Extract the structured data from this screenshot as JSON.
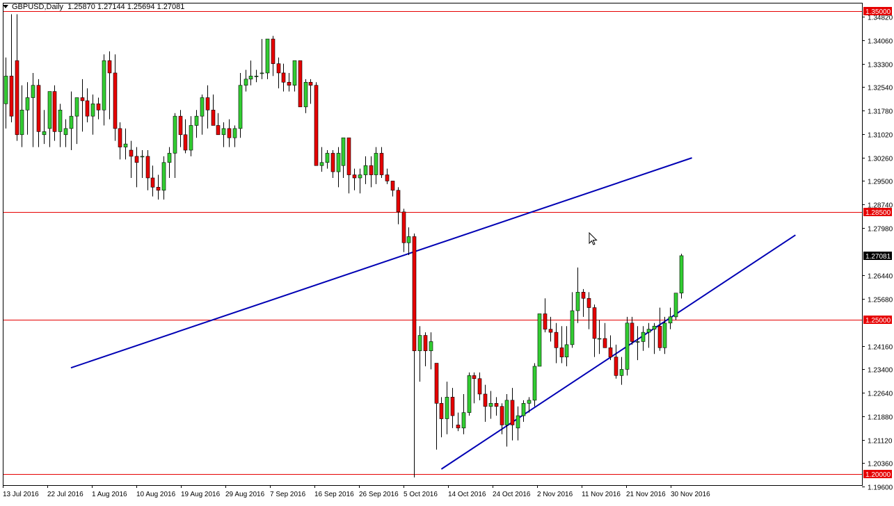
{
  "header": {
    "symbol": "GBPUSD,Daily",
    "ohlc": "1.25870 1.27144 1.25694 1.27081"
  },
  "colors": {
    "bull_fill": "#32cd32",
    "bear_fill": "#e60000",
    "wick": "#000000",
    "hline": "#e60000",
    "trendline": "#0000b4",
    "price_label_bg": "#e60000",
    "current_label_bg": "#000000"
  },
  "chart_data": {
    "type": "candlestick",
    "symbol": "GBPUSD",
    "timeframe": "Daily",
    "last_ohlc": {
      "open": 1.2587,
      "high": 1.27144,
      "low": 1.25694,
      "close": 1.27081
    },
    "ylim": [
      1.1965,
      1.3525
    ],
    "y_ticks": [
      "1.34820",
      "1.34060",
      "1.33300",
      "1.32540",
      "1.31780",
      "1.31020",
      "1.30260",
      "1.29500",
      "1.28740",
      "1.27980",
      "1.26440",
      "1.25680",
      "1.24160",
      "1.23400",
      "1.22640",
      "1.21880",
      "1.21120",
      "1.20360",
      "1.19600"
    ],
    "x_labels": [
      "13 Jul 2016",
      "22 Jul 2016",
      "1 Aug 2016",
      "10 Aug 2016",
      "19 Aug 2016",
      "29 Aug 2016",
      "7 Sep 2016",
      "16 Sep 2016",
      "26 Sep 2016",
      "5 Oct 2016",
      "14 Oct 2016",
      "24 Oct 2016",
      "2 Nov 2016",
      "11 Nov 2016",
      "21 Nov 2016",
      "30 Nov 2016"
    ],
    "horizontal_levels": [
      {
        "price": 1.35,
        "label": "1.35000"
      },
      {
        "price": 1.285,
        "label": "1.28500"
      },
      {
        "price": 1.25,
        "label": "1.25000"
      },
      {
        "price": 1.2,
        "label": "1.20000"
      }
    ],
    "current_price": {
      "price": 1.27081,
      "label": "1.27081"
    },
    "trendlines": [
      {
        "name": "channel-upper",
        "from": [
          12,
          1.2345
        ],
        "to": [
          126,
          1.3025
        ]
      },
      {
        "name": "channel-lower",
        "from": [
          80,
          1.2017
        ],
        "to": [
          145,
          1.2775
        ]
      }
    ],
    "candles": [
      [
        1.32,
        1.335,
        1.312,
        1.329
      ],
      [
        1.329,
        1.349,
        1.314,
        1.316
      ],
      [
        1.334,
        1.349,
        1.308,
        1.31
      ],
      [
        1.31,
        1.326,
        1.306,
        1.318
      ],
      [
        1.318,
        1.327,
        1.31,
        1.322
      ],
      [
        1.322,
        1.33,
        1.306,
        1.326
      ],
      [
        1.326,
        1.328,
        1.306,
        1.311
      ],
      [
        1.31,
        1.318,
        1.307,
        1.311
      ],
      [
        1.312,
        1.322,
        1.306,
        1.324
      ],
      [
        1.324,
        1.326,
        1.308,
        1.311
      ],
      [
        1.311,
        1.32,
        1.306,
        1.318
      ],
      [
        1.31,
        1.315,
        1.306,
        1.312
      ],
      [
        1.312,
        1.324,
        1.305,
        1.316
      ],
      [
        1.316,
        1.322,
        1.307,
        1.322
      ],
      [
        1.322,
        1.328,
        1.311,
        1.321
      ],
      [
        1.321,
        1.325,
        1.314,
        1.316
      ],
      [
        1.316,
        1.323,
        1.31,
        1.32
      ],
      [
        1.32,
        1.322,
        1.315,
        1.318
      ],
      [
        1.318,
        1.336,
        1.313,
        1.334
      ],
      [
        1.334,
        1.337,
        1.315,
        1.33
      ],
      [
        1.33,
        1.336,
        1.308,
        1.312
      ],
      [
        1.312,
        1.314,
        1.302,
        1.306
      ],
      [
        1.306,
        1.312,
        1.302,
        1.307
      ],
      [
        1.305,
        1.308,
        1.296,
        1.303
      ],
      [
        1.303,
        1.306,
        1.293,
        1.301
      ],
      [
        1.303,
        1.305,
        1.296,
        1.303
      ],
      [
        1.303,
        1.305,
        1.292,
        1.296
      ],
      [
        1.296,
        1.3,
        1.29,
        1.293
      ],
      [
        1.293,
        1.297,
        1.289,
        1.292
      ],
      [
        1.292,
        1.303,
        1.289,
        1.301
      ],
      [
        1.301,
        1.306,
        1.296,
        1.304
      ],
      [
        1.304,
        1.317,
        1.296,
        1.316
      ],
      [
        1.316,
        1.318,
        1.306,
        1.31
      ],
      [
        1.31,
        1.315,
        1.304,
        1.305
      ],
      [
        1.305,
        1.316,
        1.303,
        1.313
      ],
      [
        1.313,
        1.318,
        1.309,
        1.316
      ],
      [
        1.316,
        1.323,
        1.31,
        1.322
      ],
      [
        1.322,
        1.326,
        1.312,
        1.318
      ],
      [
        1.318,
        1.323,
        1.313,
        1.313
      ],
      [
        1.313,
        1.317,
        1.31,
        1.31
      ],
      [
        1.31,
        1.314,
        1.306,
        1.312
      ],
      [
        1.312,
        1.315,
        1.306,
        1.309
      ],
      [
        1.309,
        1.313,
        1.306,
        1.312
      ],
      [
        1.312,
        1.33,
        1.309,
        1.326
      ],
      [
        1.326,
        1.331,
        1.324,
        1.328
      ],
      [
        1.328,
        1.334,
        1.326,
        1.329
      ],
      [
        1.329,
        1.331,
        1.327,
        1.329
      ],
      [
        1.33,
        1.341,
        1.328,
        1.33
      ],
      [
        1.33,
        1.341,
        1.328,
        1.341
      ],
      [
        1.341,
        1.342,
        1.329,
        1.333
      ],
      [
        1.333,
        1.335,
        1.325,
        1.33
      ],
      [
        1.33,
        1.333,
        1.324,
        1.327
      ],
      [
        1.327,
        1.33,
        1.324,
        1.326
      ],
      [
        1.326,
        1.334,
        1.324,
        1.334
      ],
      [
        1.334,
        1.334,
        1.319,
        1.319
      ],
      [
        1.319,
        1.328,
        1.317,
        1.327
      ],
      [
        1.327,
        1.328,
        1.32,
        1.326
      ],
      [
        1.326,
        1.327,
        1.301,
        1.3
      ],
      [
        1.3,
        1.306,
        1.298,
        1.301
      ],
      [
        1.301,
        1.305,
        1.299,
        1.304
      ],
      [
        1.304,
        1.305,
        1.296,
        1.298
      ],
      [
        1.298,
        1.306,
        1.293,
        1.304
      ],
      [
        1.3,
        1.309,
        1.296,
        1.309
      ],
      [
        1.309,
        1.309,
        1.291,
        1.297
      ],
      [
        1.297,
        1.299,
        1.292,
        1.296
      ],
      [
        1.296,
        1.299,
        1.291,
        1.297
      ],
      [
        1.297,
        1.303,
        1.294,
        1.3
      ],
      [
        1.3,
        1.303,
        1.293,
        1.297
      ],
      [
        1.297,
        1.306,
        1.294,
        1.304
      ],
      [
        1.304,
        1.306,
        1.296,
        1.297
      ],
      [
        1.297,
        1.299,
        1.294,
        1.295
      ],
      [
        1.295,
        1.295,
        1.29,
        1.292
      ],
      [
        1.292,
        1.293,
        1.281,
        1.285
      ],
      [
        1.285,
        1.286,
        1.272,
        1.275
      ],
      [
        1.275,
        1.28,
        1.271,
        1.277
      ],
      [
        1.277,
        1.278,
        1.199,
        1.24
      ],
      [
        1.24,
        1.248,
        1.23,
        1.245
      ],
      [
        1.245,
        1.246,
        1.235,
        1.24
      ],
      [
        1.24,
        1.246,
        1.234,
        1.243
      ],
      [
        1.236,
        1.236,
        1.208,
        1.223
      ],
      [
        1.223,
        1.225,
        1.212,
        1.218
      ],
      [
        1.218,
        1.23,
        1.213,
        1.225
      ],
      [
        1.225,
        1.228,
        1.215,
        1.219
      ],
      [
        1.216,
        1.22,
        1.214,
        1.215
      ],
      [
        1.215,
        1.226,
        1.213,
        1.22
      ],
      [
        1.22,
        1.233,
        1.219,
        1.232
      ],
      [
        1.232,
        1.233,
        1.223,
        1.231
      ],
      [
        1.231,
        1.233,
        1.224,
        1.226
      ],
      [
        1.226,
        1.229,
        1.217,
        1.222
      ],
      [
        1.222,
        1.227,
        1.218,
        1.223
      ],
      [
        1.223,
        1.225,
        1.219,
        1.222
      ],
      [
        1.222,
        1.223,
        1.213,
        1.216
      ],
      [
        1.216,
        1.226,
        1.209,
        1.224
      ],
      [
        1.224,
        1.228,
        1.211,
        1.216
      ],
      [
        1.215,
        1.222,
        1.211,
        1.219
      ],
      [
        1.219,
        1.224,
        1.217,
        1.223
      ],
      [
        1.223,
        1.225,
        1.22,
        1.224
      ],
      [
        1.224,
        1.236,
        1.222,
        1.235
      ],
      [
        1.235,
        1.252,
        1.235,
        1.252
      ],
      [
        1.252,
        1.257,
        1.246,
        1.247
      ],
      [
        1.247,
        1.251,
        1.243,
        1.246
      ],
      [
        1.246,
        1.249,
        1.236,
        1.241
      ],
      [
        1.241,
        1.248,
        1.236,
        1.238
      ],
      [
        1.238,
        1.248,
        1.235,
        1.242
      ],
      [
        1.242,
        1.259,
        1.241,
        1.253
      ],
      [
        1.253,
        1.267,
        1.249,
        1.259
      ],
      [
        1.259,
        1.26,
        1.251,
        1.257
      ],
      [
        1.257,
        1.259,
        1.247,
        1.254
      ],
      [
        1.254,
        1.255,
        1.238,
        1.244
      ],
      [
        1.244,
        1.25,
        1.239,
        1.244
      ],
      [
        1.244,
        1.249,
        1.241,
        1.241
      ],
      [
        1.241,
        1.245,
        1.237,
        1.238
      ],
      [
        1.238,
        1.242,
        1.231,
        1.232
      ],
      [
        1.232,
        1.238,
        1.229,
        1.234
      ],
      [
        1.234,
        1.251,
        1.232,
        1.249
      ],
      [
        1.249,
        1.251,
        1.242,
        1.243
      ],
      [
        1.243,
        1.248,
        1.237,
        1.243
      ],
      [
        1.243,
        1.248,
        1.24,
        1.246
      ],
      [
        1.246,
        1.249,
        1.241,
        1.247
      ],
      [
        1.247,
        1.249,
        1.239,
        1.248
      ],
      [
        1.248,
        1.254,
        1.24,
        1.241
      ],
      [
        1.241,
        1.251,
        1.239,
        1.249
      ],
      [
        1.249,
        1.254,
        1.247,
        1.251
      ],
      [
        1.251,
        1.258,
        1.25,
        1.2587
      ],
      [
        1.2587,
        1.27144,
        1.25694,
        1.27081
      ]
    ]
  }
}
